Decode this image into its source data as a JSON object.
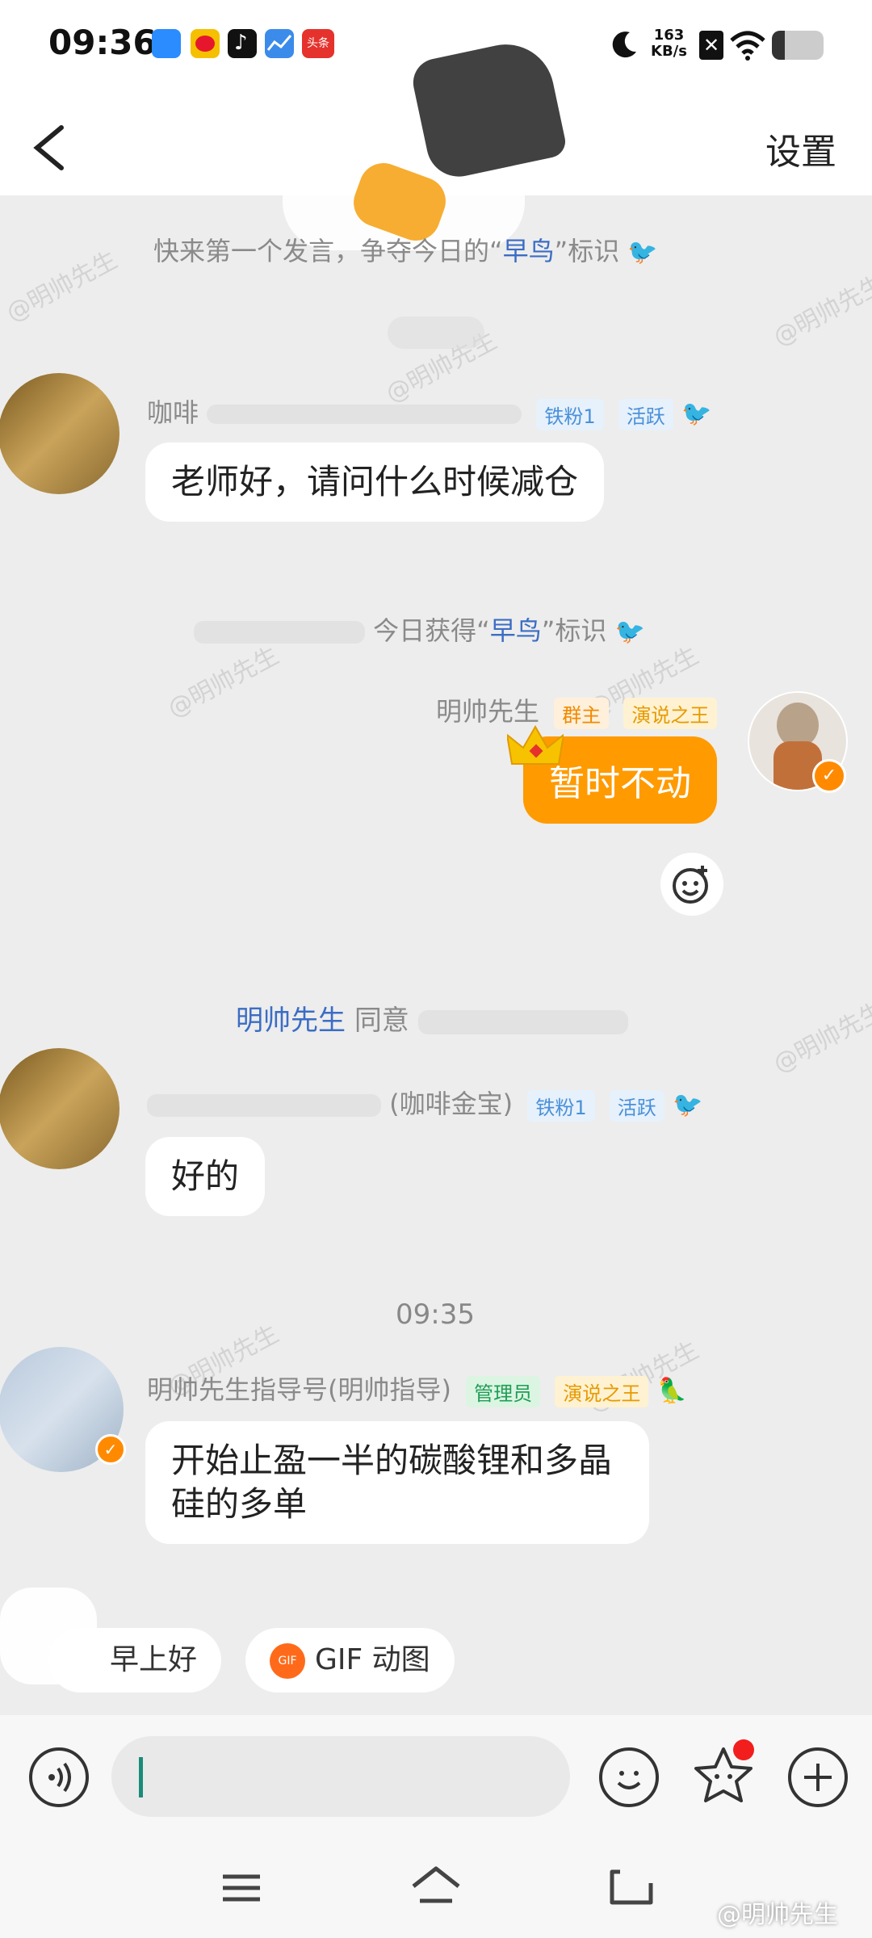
{
  "status": {
    "time": "09:36",
    "speed_value": "163",
    "speed_unit": "KB/s",
    "app_badge": "头条"
  },
  "header": {
    "settings": "设置"
  },
  "notices": {
    "first_speak_pre": "快来第一个发言，争夺今日的“",
    "early_bird": "早鸟",
    "first_speak_post": "”标识",
    "got_pre": "今日获得“",
    "got_post": "”标识",
    "approve_name": "明帅先生",
    "approve_text": "同意"
  },
  "messages": [
    {
      "sender": "咖啡",
      "badges": [
        "铁粉1",
        "活跃"
      ],
      "text": "老师好，请问什么时候减仓"
    },
    {
      "sender": "明帅先生",
      "badges": [
        "群主",
        "演说之王"
      ],
      "text": "暂时不动"
    },
    {
      "sender": "(咖啡金宝)",
      "badges": [
        "铁粉1",
        "活跃"
      ],
      "text": "好的"
    },
    {
      "sender": "明帅先生指导号(明帅指导)",
      "badges": [
        "管理员",
        "演说之王"
      ],
      "text": "开始止盈一半的碳酸锂和多晶硅的多单"
    }
  ],
  "timestamp": "09:35",
  "quick_replies": [
    "早上好",
    "GIF 动图"
  ],
  "gif_badge": "GIF",
  "watermark_footer": "@明帅先生",
  "watermark_text": "@明帅先生"
}
